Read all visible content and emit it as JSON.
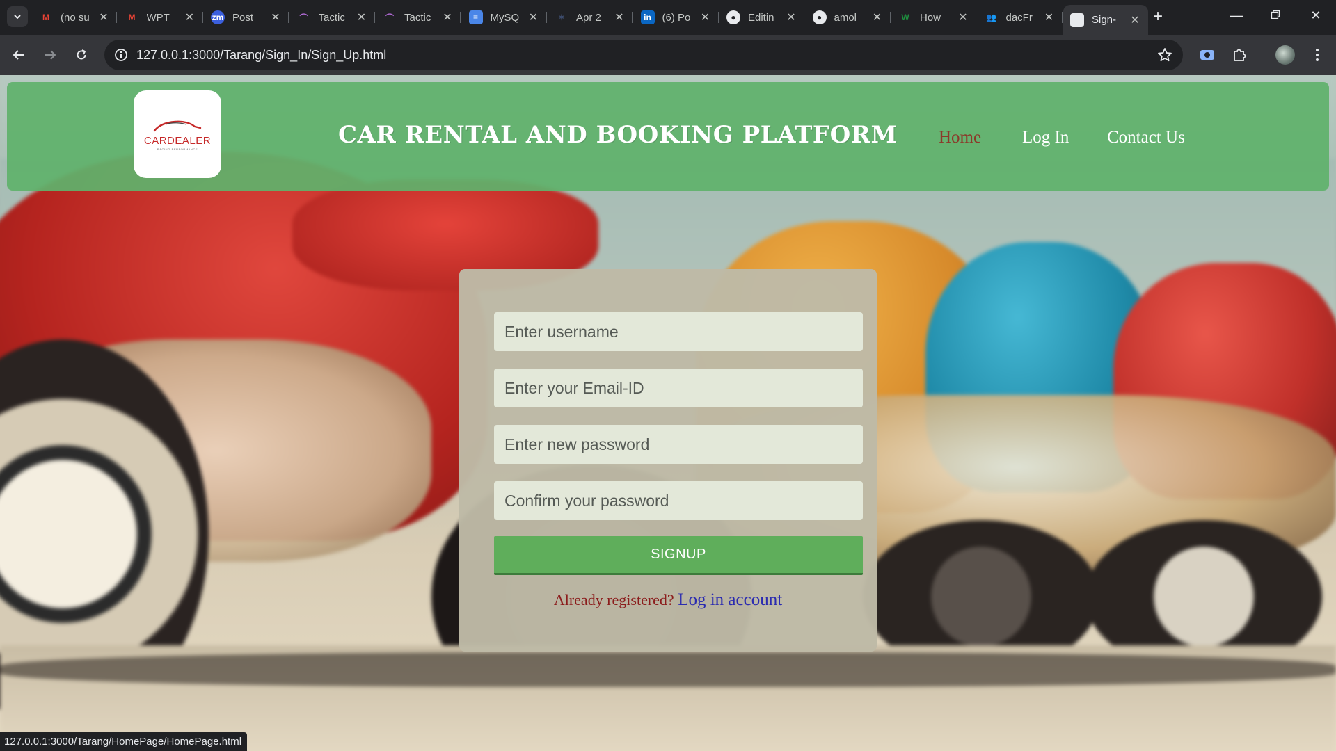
{
  "browser": {
    "tabs": [
      {
        "label": "(no su",
        "favicon": "gmail-icon",
        "color": "#ea4335",
        "glyph": "M"
      },
      {
        "label": "WPT",
        "favicon": "gmail-icon",
        "color": "#ea4335",
        "glyph": "M"
      },
      {
        "label": "Post",
        "favicon": "zm-icon",
        "color": "#3b5fdd",
        "glyph": "zm"
      },
      {
        "label": "Tactic",
        "favicon": "tactiq-icon",
        "color": "#b36bd8",
        "glyph": "⌒"
      },
      {
        "label": "Tactic",
        "favicon": "tactiq-icon",
        "color": "#b36bd8",
        "glyph": "⌒"
      },
      {
        "label": "MySQ",
        "favicon": "docs-icon",
        "color": "#4a86e8",
        "glyph": "≡"
      },
      {
        "label": "Apr 2",
        "favicon": "sparkle-icon",
        "color": "#3c4b6b",
        "glyph": "✶"
      },
      {
        "label": "(6) Po",
        "favicon": "linkedin-icon",
        "color": "#0a66c2",
        "glyph": "in"
      },
      {
        "label": "Editin",
        "favicon": "github-icon",
        "color": "#202124",
        "glyph": "●"
      },
      {
        "label": "amol",
        "favicon": "github-icon",
        "color": "#202124",
        "glyph": "●"
      },
      {
        "label": "How",
        "favicon": "w-icon",
        "color": "#1e8e3e",
        "glyph": "W"
      },
      {
        "label": "dacFr",
        "favicon": "people-icon",
        "color": "#4a6de0",
        "glyph": "👥"
      },
      {
        "label": "Sign-",
        "favicon": "page-icon",
        "color": "#e8eaed",
        "glyph": ""
      }
    ],
    "url": "127.0.0.1:3000/Tarang/Sign_In/Sign_Up.html",
    "status_url": "127.0.0.1:3000/Tarang/HomePage/HomePage.html"
  },
  "header": {
    "logo_text": "CARDEALER",
    "logo_subtext": "RACING PERFORMANCE",
    "title": "CAR RENTAL AND BOOKING PLATFORM",
    "nav": [
      {
        "label": "Home",
        "current": true
      },
      {
        "label": "Log In",
        "current": false
      },
      {
        "label": "Contact Us",
        "current": false
      }
    ]
  },
  "form": {
    "username_placeholder": "Enter username",
    "email_placeholder": "Enter your Email-ID",
    "password_placeholder": "Enter new password",
    "confirm_placeholder": "Confirm your password",
    "submit_label": "SIGNUP",
    "already_text": "Already registered?",
    "login_link": "Log in account"
  },
  "colors": {
    "header_green": "#60b26c",
    "button_green": "#5fae5b",
    "current_nav": "#8b3a2a"
  }
}
